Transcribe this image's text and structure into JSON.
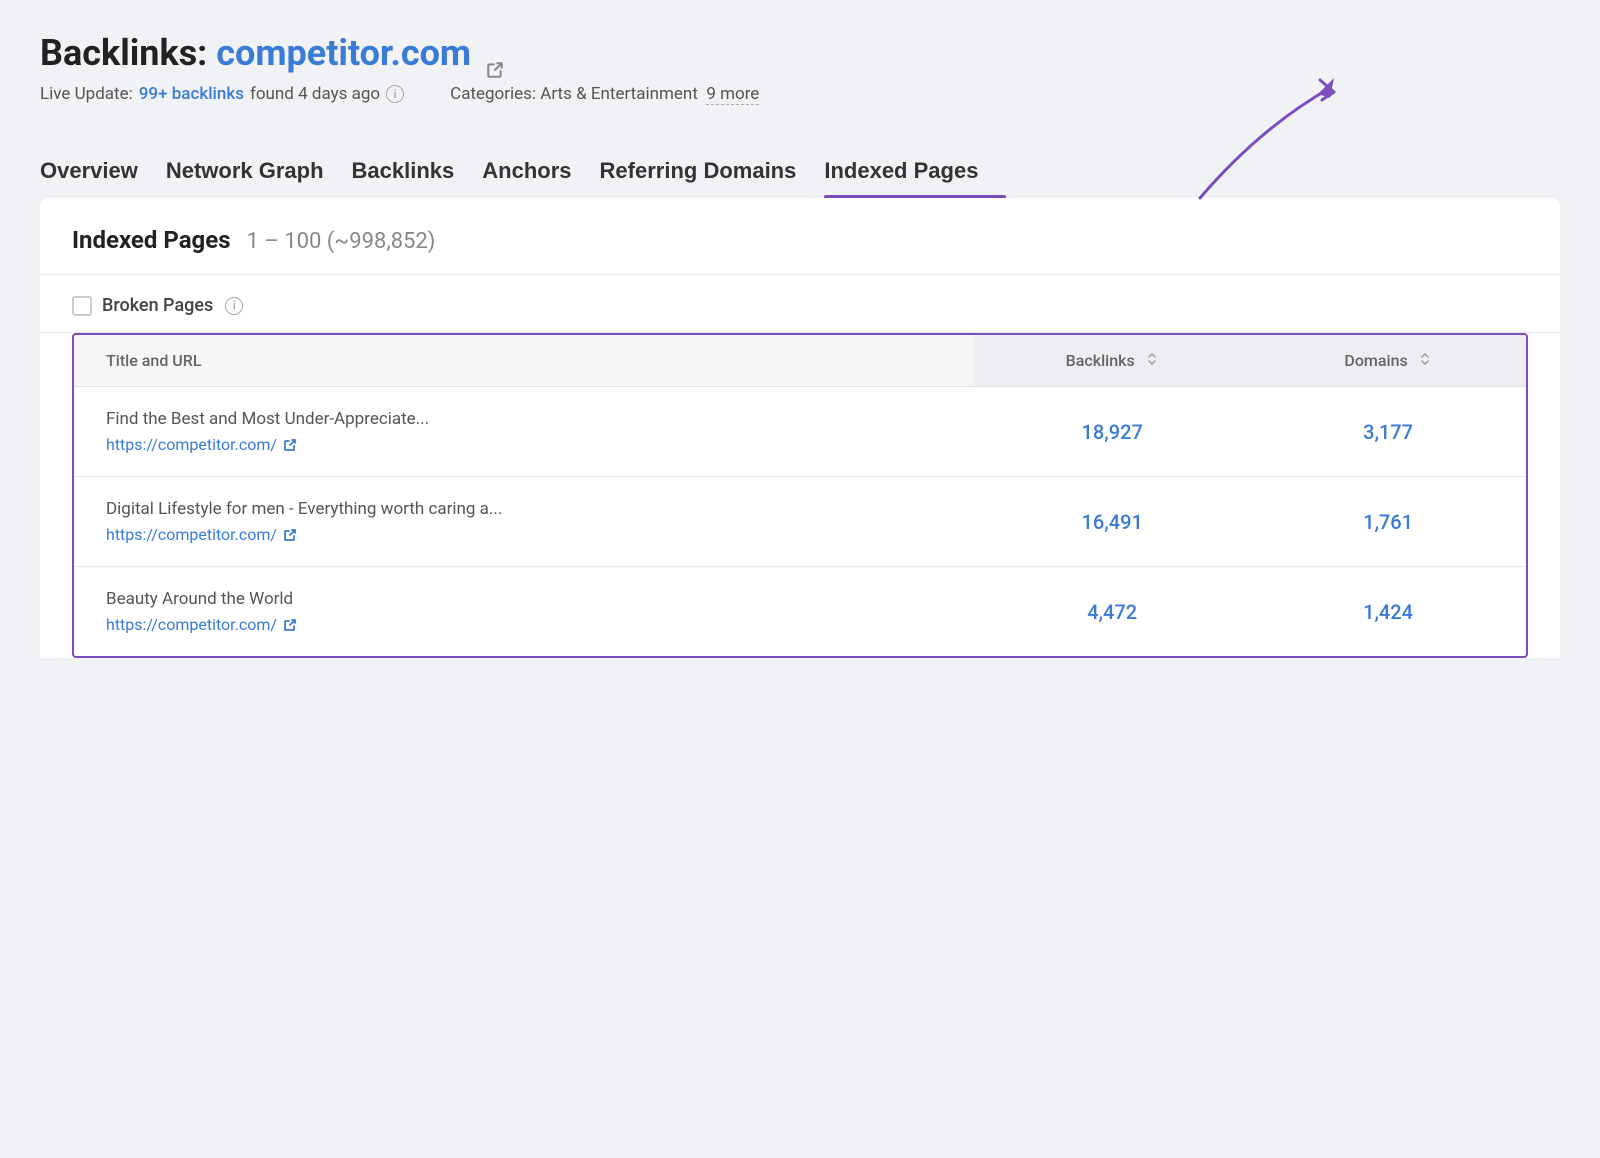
{
  "header": {
    "title_prefix": "Backlinks: ",
    "domain": "competitor.com",
    "live_update_prefix": "Live Update: ",
    "backlinks_count": "99+ backlinks",
    "live_update_suffix": "found 4 days ago",
    "info_icon_label": "i",
    "categories_prefix": "Categories: Arts & Entertainment",
    "more_label": "9 more"
  },
  "nav": {
    "tabs": [
      {
        "label": "Overview",
        "active": false
      },
      {
        "label": "Network Graph",
        "active": false
      },
      {
        "label": "Backlinks",
        "active": false
      },
      {
        "label": "Anchors",
        "active": false
      },
      {
        "label": "Referring Domains",
        "active": false
      },
      {
        "label": "Indexed Pages",
        "active": true
      }
    ]
  },
  "indexed_pages": {
    "section_title": "Indexed Pages",
    "count_range": "1 – 100 (~998,852)",
    "broken_pages_label": "Broken Pages",
    "table": {
      "col_title": "Title and URL",
      "col_backlinks": "Backlinks",
      "col_domains": "Domains",
      "rows": [
        {
          "title": "Find the Best and Most Under-Appreciate...",
          "url": "https://competitor.com/",
          "backlinks": "18,927",
          "domains": "3,177"
        },
        {
          "title": "Digital Lifestyle for men - Everything worth caring a...",
          "url": "https://competitor.com/",
          "backlinks": "16,491",
          "domains": "1,761"
        },
        {
          "title": "Beauty Around the World",
          "url": "https://competitor.com/",
          "backlinks": "4,472",
          "domains": "1,424"
        }
      ]
    }
  },
  "colors": {
    "accent_purple": "#7c4dbd",
    "link_blue": "#3a7bd5",
    "border_light": "#e8eaed"
  }
}
